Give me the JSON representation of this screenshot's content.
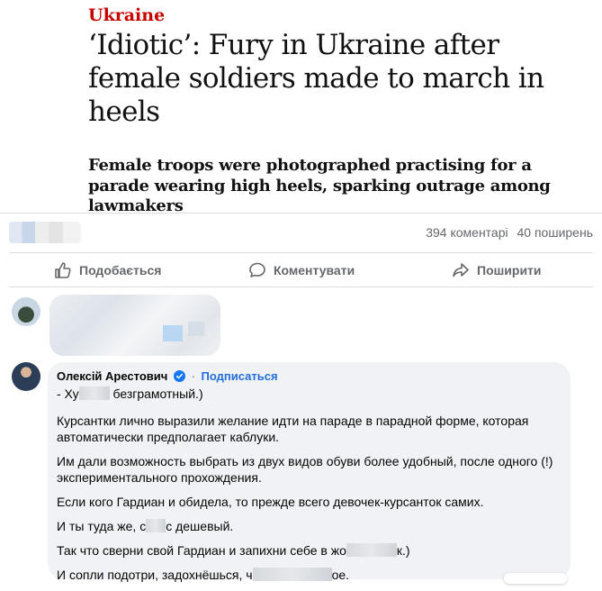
{
  "article": {
    "kicker": "Ukraine",
    "headline": "‘Idiotic’: Fury in Ukraine after female soldiers made to march in heels",
    "standfirst": "Female troops were photographed practising for a parade wearing high heels, sparking outrage among lawmakers"
  },
  "stats": {
    "comments": "394 коментарі",
    "shares": "40 поширень"
  },
  "actions": {
    "like": "Подобається",
    "comment": "Коментувати",
    "share": "Поширити"
  },
  "comment": {
    "author": "Олексій Арестович",
    "follow": "Подписаться",
    "reply_prefix": "- Ху",
    "reply_suffix": " безграмотный.)",
    "p1": "Курсантки лично выразили желание идти на параде в парадной форме, которая автоматически предполагает каблуки.",
    "p2": "Им дали возможность выбрать из двух видов обуви более удобный, после одного (!) экспериментального прохождения.",
    "p3": "Если кого Гардиан и обидела, то прежде всего девочек-курсанток самих.",
    "p4_prefix": "И ты туда же, с",
    "p4_suffix": "с дешевый.",
    "p5_prefix": "Так что сверни свой Гардиан и запихни себе в жо",
    "p5_suffix": "к.)",
    "p6_prefix": "И сопли подотри, задохнёшься, ч",
    "p6_suffix": "ое."
  },
  "colors": {
    "kicker": "#c70000",
    "link": "#216fdb",
    "bubble": "#f0f2f5",
    "muted": "#65676b"
  }
}
